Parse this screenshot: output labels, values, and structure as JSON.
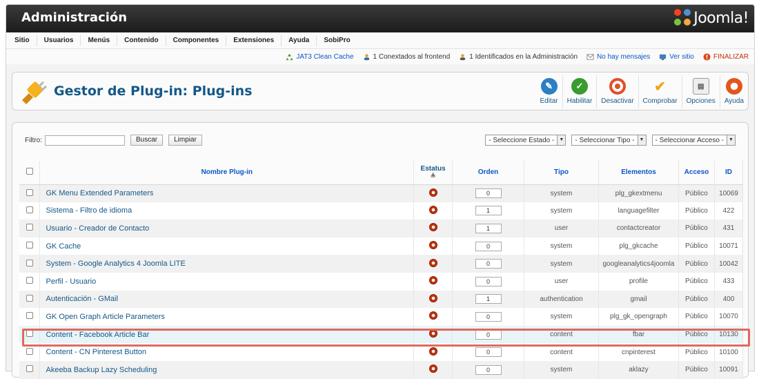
{
  "header": {
    "title": "Administración",
    "logo_text": "Joomla!"
  },
  "menu": [
    "Sitio",
    "Usuarios",
    "Menús",
    "Contenido",
    "Componentes",
    "Extensiones",
    "Ayuda",
    "SobiPro"
  ],
  "status": {
    "cache": "JAT3 Clean Cache",
    "frontend": "1 Conextados al frontend",
    "admin": "1 Identificados en la Administración",
    "messages": "No hay mensajes",
    "site": "Ver sitio",
    "logout": "FINALIZAR"
  },
  "page": {
    "title": "Gestor de Plug-in: Plug-ins"
  },
  "toolbar": {
    "edit": "Editar",
    "enable": "Habilitar",
    "disable": "Desactivar",
    "check": "Comprobar",
    "options": "Opciones",
    "help": "Ayuda"
  },
  "filter": {
    "label": "Filtro:",
    "value": "",
    "search": "Buscar",
    "clear": "Limpiar",
    "state": "- Seleccione Estado -",
    "type": "- Seleccionar Tipo -",
    "access": "- Seleccionar Acceso -"
  },
  "table": {
    "headers": {
      "name": "Nombre Plug-in",
      "status": "Estatus",
      "order": "Orden",
      "type": "Tipo",
      "elements": "Elementos",
      "access": "Acceso",
      "id": "ID"
    },
    "rows": [
      {
        "name": "GK Menu Extended Parameters",
        "order": "0",
        "type": "system",
        "element": "plg_gkextmenu",
        "access": "Público",
        "id": "10069"
      },
      {
        "name": "Sistema - Filtro de idioma",
        "order": "1",
        "type": "system",
        "element": "languagefilter",
        "access": "Público",
        "id": "422"
      },
      {
        "name": "Usuario - Creador de Contacto",
        "order": "1",
        "type": "user",
        "element": "contactcreator",
        "access": "Público",
        "id": "431"
      },
      {
        "name": "GK Cache",
        "order": "0",
        "type": "system",
        "element": "plg_gkcache",
        "access": "Público",
        "id": "10071"
      },
      {
        "name": "System - Google Analytics 4 Joomla LITE",
        "order": "0",
        "type": "system",
        "element": "googleanalytics4joomla",
        "access": "Público",
        "id": "10042"
      },
      {
        "name": "Perfil - Usuario",
        "order": "0",
        "type": "user",
        "element": "profile",
        "access": "Público",
        "id": "433"
      },
      {
        "name": "Autenticación - GMail",
        "order": "1",
        "type": "authentication",
        "element": "gmail",
        "access": "Público",
        "id": "400"
      },
      {
        "name": "GK Open Graph Article Parameters",
        "order": "0",
        "type": "system",
        "element": "plg_gk_opengraph",
        "access": "Público",
        "id": "10070"
      },
      {
        "name": "Content - Facebook Article Bar",
        "order": "0",
        "type": "content",
        "element": "fbar",
        "access": "Público",
        "id": "10130"
      },
      {
        "name": "Content - CN Pinterest Button",
        "order": "0",
        "type": "content",
        "element": "cnpinterest",
        "access": "Público",
        "id": "10100"
      },
      {
        "name": "Akeeba Backup Lazy Scheduling",
        "order": "0",
        "type": "system",
        "element": "aklazy",
        "access": "Público",
        "id": "10091"
      }
    ]
  },
  "colors": {
    "accent": "#145888",
    "highlight": "#e0695c",
    "status_dot": "#c3320c"
  }
}
